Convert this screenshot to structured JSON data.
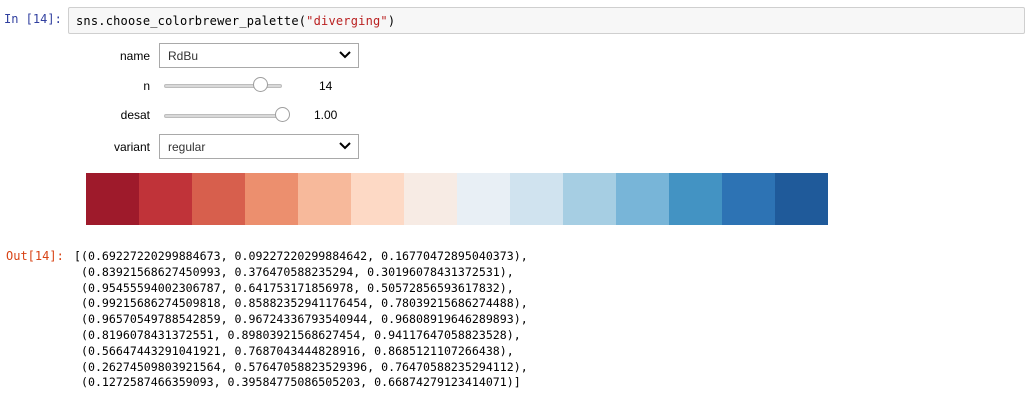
{
  "input_cell": {
    "prompt": "In  [14]:",
    "code_func": "sns.choose_colorbrewer_palette(",
    "code_arg": "\"diverging\"",
    "code_close": ")"
  },
  "widgets": {
    "name": {
      "label": "name",
      "value": "RdBu"
    },
    "n": {
      "label": "n",
      "value": "14",
      "fraction": 0.85
    },
    "desat": {
      "label": "desat",
      "value": "1.00",
      "fraction": 1.0
    },
    "variant": {
      "label": "variant",
      "value": "regular"
    }
  },
  "palette": {
    "colors": [
      "#9e1a2b",
      "#c03339",
      "#d75f4d",
      "#ec8f6e",
      "#f7b99b",
      "#fdd9c5",
      "#f7ebe4",
      "#e8eff5",
      "#d0e3ef",
      "#a6cee3",
      "#78b5d8",
      "#4393c3",
      "#2d73b4",
      "#1f5a9a"
    ]
  },
  "output_cell": {
    "prompt": "Out[14]:",
    "lines": [
      "[(0.69227220299884673, 0.09227220299884642, 0.16770472895040373),",
      " (0.83921568627450993, 0.376470588235294, 0.30196078431372531),",
      " (0.95455594002306787, 0.641753171856978, 0.50572856593617832),",
      " (0.99215686274509818, 0.85882352941176454, 0.78039215686274488),",
      " (0.96570549788542859, 0.96724336793540944, 0.96808919646289893),",
      " (0.8196078431372551, 0.89803921568627454, 0.94117647058823528),",
      " (0.56647443291041921, 0.7687043444828916, 0.8685121107266438),",
      " (0.26274509803921564, 0.57647058823529396, 0.76470588235294112),",
      " (0.1272587466359093, 0.39584775086505203, 0.66874279123414071)]"
    ]
  }
}
